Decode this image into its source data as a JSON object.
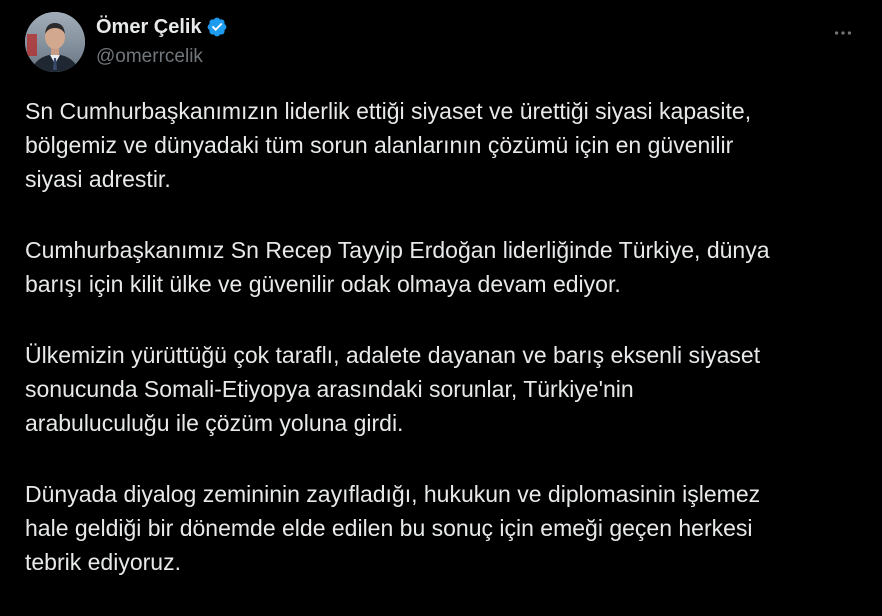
{
  "author": {
    "display_name": "Ömer Çelik",
    "handle": "@omerrcelik",
    "verified_icon": "verified-badge-icon",
    "verified_color": "#1d9bf0"
  },
  "menu": {
    "more_icon": "more-options-icon"
  },
  "tweet": {
    "paragraphs": [
      "Sn Cumhurbaşkanımızın liderlik ettiği siyaset ve ürettiği siyasi kapasite,\nbölgemiz ve dünyadaki tüm sorun alanlarının çözümü için en güvenilir\nsiyasi adrestir.",
      "Cumhurbaşkanımız Sn Recep Tayyip Erdoğan liderliğinde Türkiye, dünya\nbarışı için kilit ülke ve güvenilir odak olmaya devam ediyor.",
      "Ülkemizin yürüttüğü çok taraflı, adalete dayanan ve barış eksenli siyaset\nsonucunda Somali-Etiyopya arasındaki sorunlar, Türkiye'nin\narabuluculuğu ile çözüm yoluna girdi.",
      "Dünyada diyalog zemininin zayıfladığı, hukukun ve diplomasinin işlemez\nhale geldiği bir dönemde elde edilen bu sonuç için emeği geçen herkesi\ntebrik ediyoruz."
    ]
  },
  "colors": {
    "background": "#000000",
    "text_primary": "#e7e9ea",
    "text_secondary": "#71767b"
  }
}
